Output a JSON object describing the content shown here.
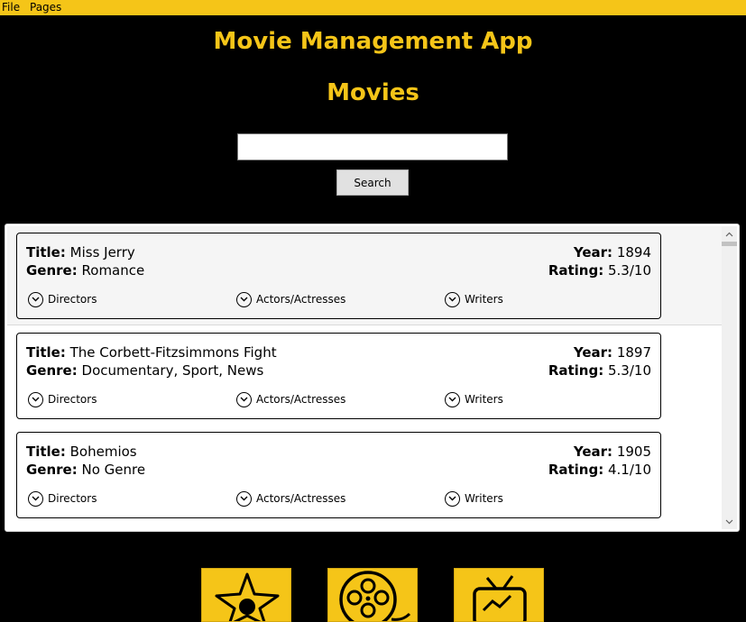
{
  "menu": {
    "file": "File",
    "pages": "Pages"
  },
  "app_title": "Movie Management App",
  "page_title": "Movies",
  "search": {
    "value": "",
    "button_label": "Search"
  },
  "movies": [
    {
      "title_label": "Title:",
      "title": "Miss Jerry",
      "genre_label": "Genre:",
      "genre": "Romance",
      "year_label": "Year:",
      "year": "1894",
      "rating_label": "Rating:",
      "rating": "5.3/10",
      "directors": "Directors",
      "actors": "Actors/Actresses",
      "writers": "Writers"
    },
    {
      "title_label": "Title:",
      "title": "The Corbett-Fitzsimmons Fight",
      "genre_label": "Genre:",
      "genre": "Documentary, Sport, News",
      "year_label": "Year:",
      "year": "1897",
      "rating_label": "Rating:",
      "rating": "5.3/10",
      "directors": "Directors",
      "actors": "Actors/Actresses",
      "writers": "Writers"
    },
    {
      "title_label": "Title:",
      "title": "Bohemios",
      "genre_label": "Genre:",
      "genre": "No Genre",
      "year_label": "Year:",
      "year": "1905",
      "rating_label": "Rating:",
      "rating": "4.1/10",
      "directors": "Directors",
      "actors": "Actors/Actresses",
      "writers": "Writers"
    }
  ],
  "bottom_nav": [
    {
      "icon": "star-icon"
    },
    {
      "icon": "film-reel-icon"
    },
    {
      "icon": "tv-chart-icon"
    }
  ],
  "colors": {
    "accent": "#f5c518",
    "background": "#000000"
  }
}
